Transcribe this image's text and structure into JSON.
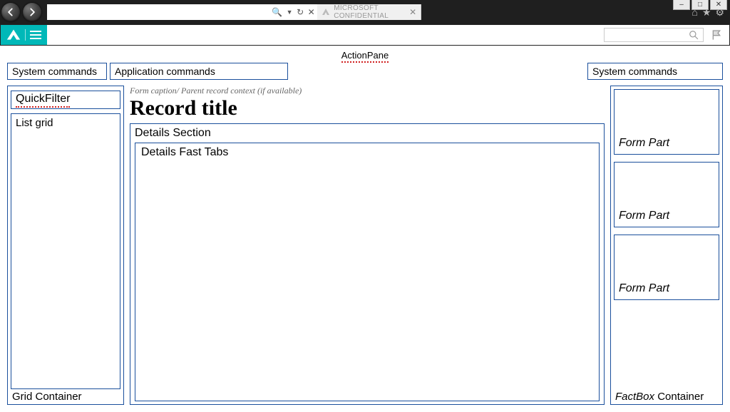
{
  "browser": {
    "tab_title": "MICROSOFT CONFIDENTIAL",
    "search_hint": "🔎 ▾ ↻ ✕"
  },
  "actionpane": {
    "label": "ActionPane",
    "system_left": "System commands",
    "application": "Application commands",
    "system_right": "System commands"
  },
  "header": {
    "caption": "Form caption/ Parent record context (if available)",
    "title": "Record title"
  },
  "grid_container": {
    "quickfilter": "QuickFilter",
    "listgrid": "List grid",
    "label": "Grid Container"
  },
  "details": {
    "section": "Details Section",
    "fasttabs": "Details Fast Tabs"
  },
  "factbox": {
    "part": "Form Part",
    "label_italic": "FactBox",
    "label_rest": " Container"
  }
}
